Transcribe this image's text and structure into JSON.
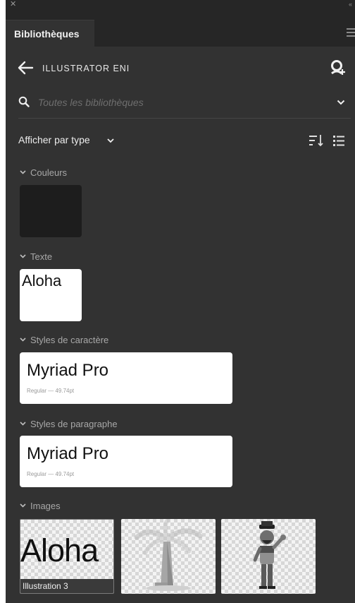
{
  "panel": {
    "tab_label": "Bibliothèques"
  },
  "library": {
    "name": "ILLUSTRATOR ENI"
  },
  "search": {
    "placeholder": "Toutes les bibliothèques"
  },
  "view": {
    "label": "Afficher par type"
  },
  "sections": {
    "colors": {
      "title": "Couleurs",
      "swatch_color": "#1d1d1d"
    },
    "text": {
      "title": "Texte",
      "sample": "Aloha"
    },
    "char_styles": {
      "title": "Styles de caractère",
      "font_name": "Myriad Pro",
      "meta": "Regular — 49.74pt"
    },
    "para_styles": {
      "title": "Styles de paragraphe",
      "font_name": "Myriad Pro",
      "meta": "Regular — 49.74pt"
    },
    "images": {
      "title": "Images",
      "items": [
        {
          "preview_text": "Aloha",
          "caption": "Illustration 3"
        },
        {
          "icon": "palm-tree-illustration"
        },
        {
          "icon": "pilot-character-illustration"
        }
      ]
    }
  },
  "colors": {
    "panel_bg": "#323232",
    "header_bg": "#262626",
    "text_primary": "#e6e6e6",
    "text_muted": "#a8a8a8"
  }
}
